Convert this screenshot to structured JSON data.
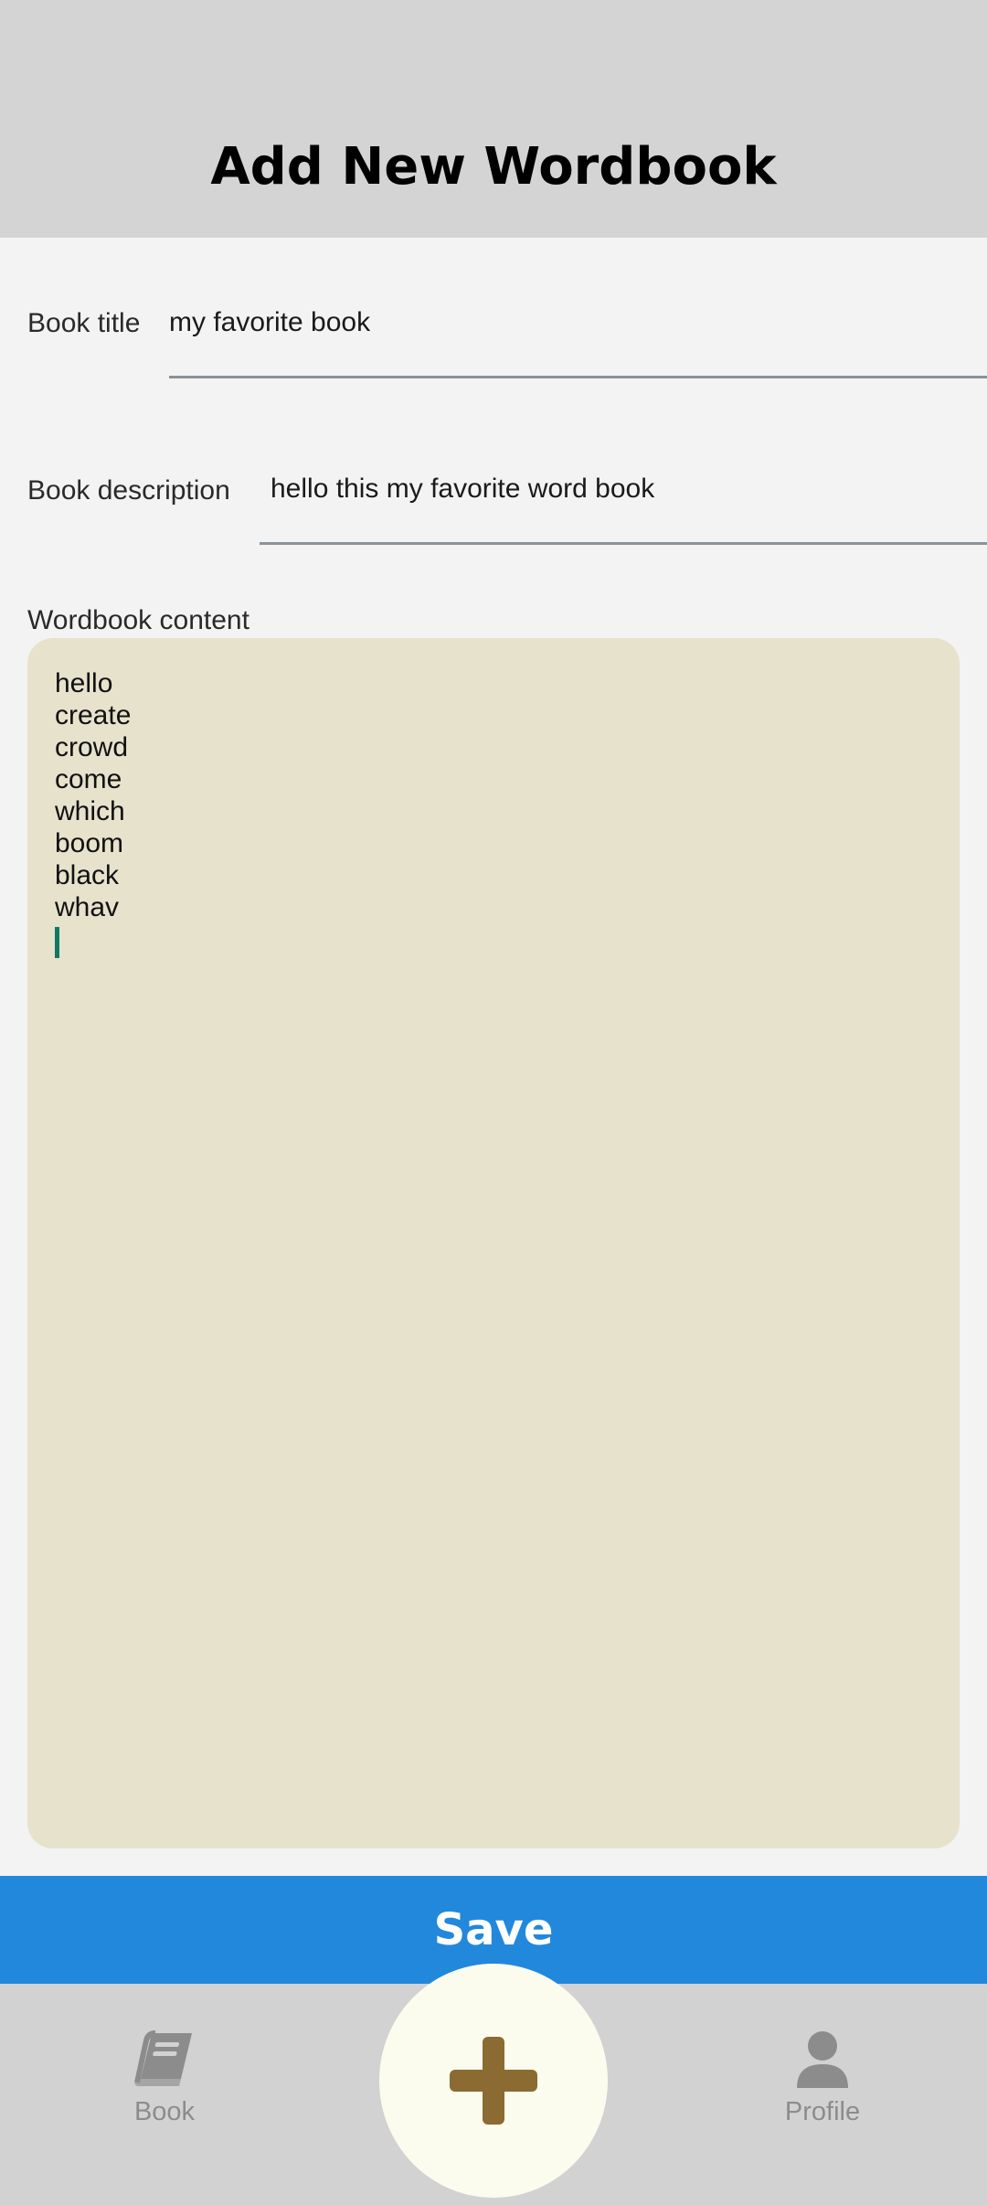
{
  "header": {
    "title": "Add New Wordbook"
  },
  "form": {
    "book_title": {
      "label": "Book title",
      "value": "my favorite book"
    },
    "book_description": {
      "label": "Book description",
      "value": "hello this my favorite word book"
    },
    "content": {
      "label": "Wordbook content",
      "lines": [
        "hello",
        "create",
        "crowd",
        "come",
        "which",
        "boom",
        "black",
        "whav"
      ]
    }
  },
  "save_label": "Save",
  "bottom_nav": {
    "book": {
      "label": "Book",
      "icon": "book-icon"
    },
    "add": {
      "icon": "plus-icon"
    },
    "profile": {
      "label": "Profile",
      "icon": "person-icon"
    }
  },
  "colors": {
    "header_bg": "#d4d4d4",
    "save_bg": "#2288dc",
    "content_bg": "#e7e2cc",
    "fab_bg": "#fcfcee",
    "fab_plus": "#8b6b32",
    "caret": "#0f7a63"
  }
}
